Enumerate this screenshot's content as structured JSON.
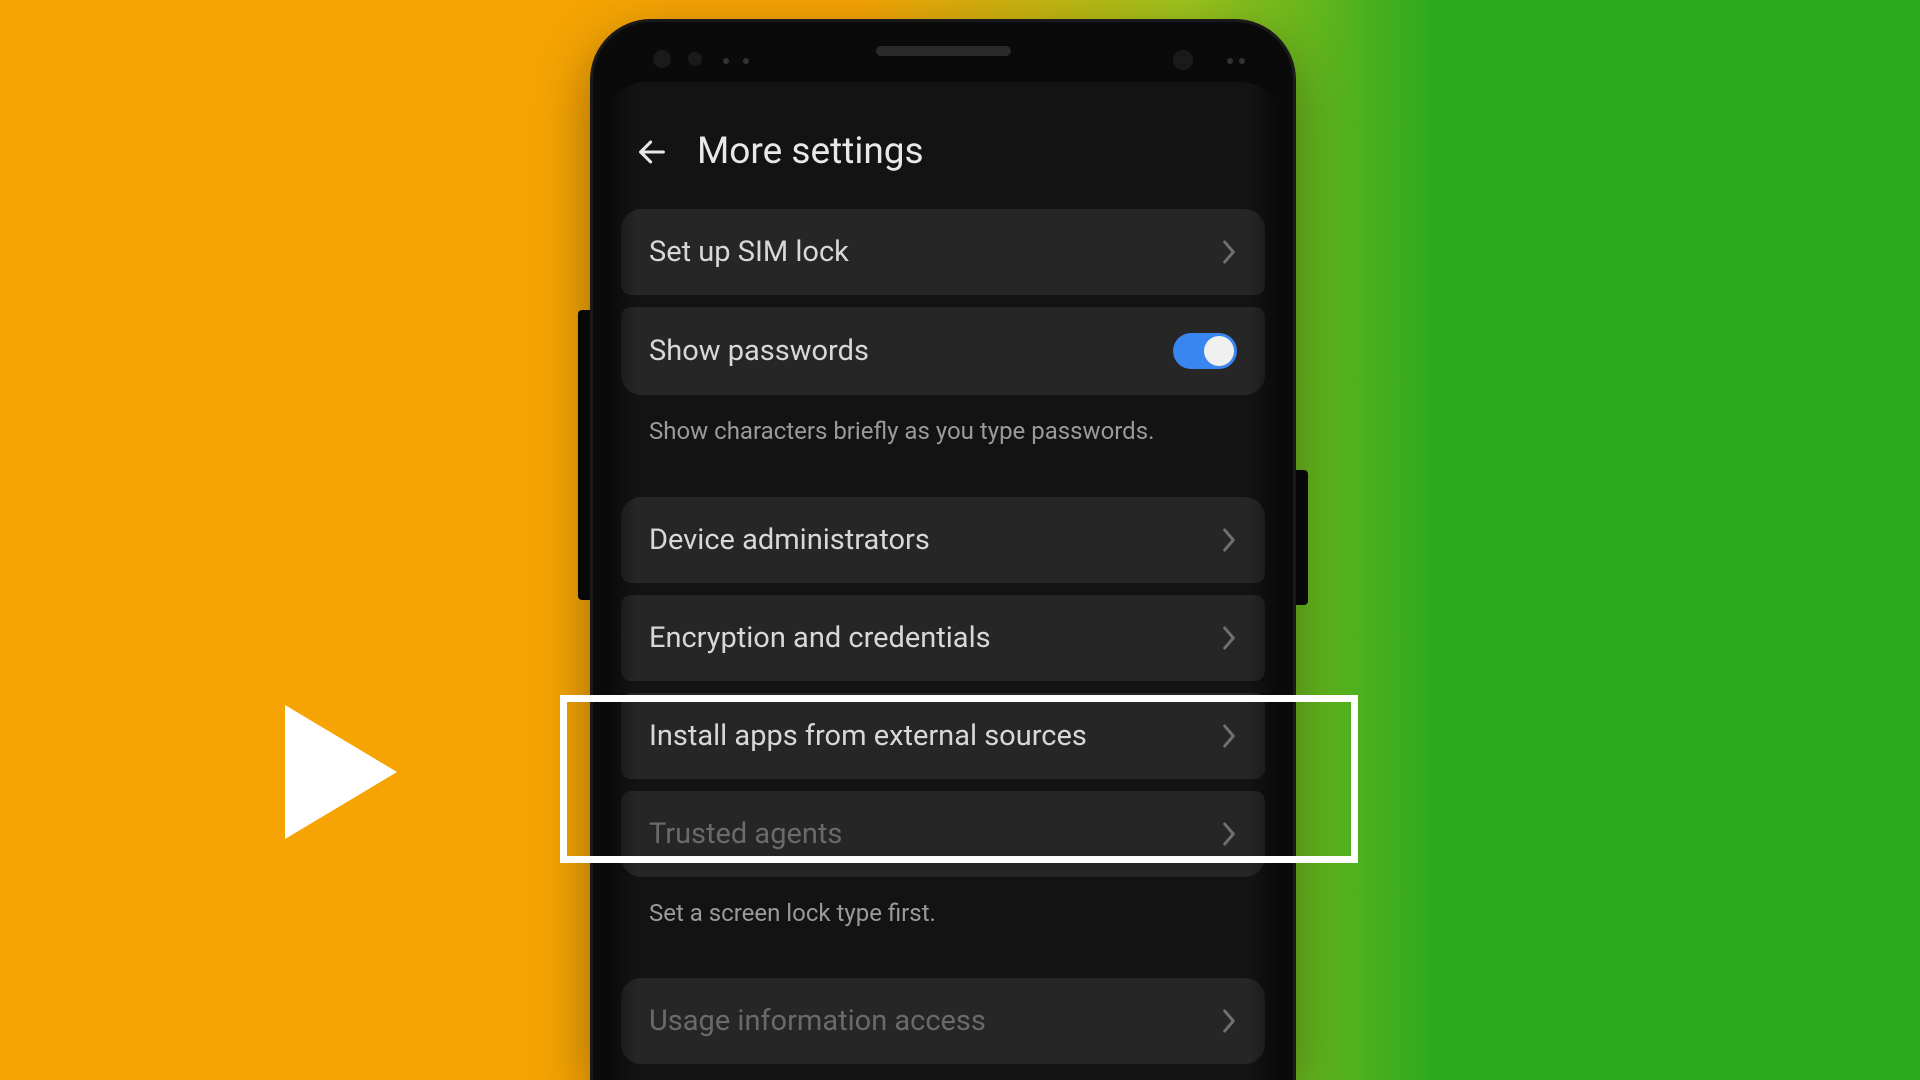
{
  "header": {
    "title": "More settings"
  },
  "settings": {
    "sim_lock": "Set up SIM lock",
    "show_passwords": "Show passwords",
    "show_passwords_desc": "Show characters briefly as you type passwords.",
    "device_admins": "Device administrators",
    "encryption": "Encryption and credentials",
    "install_external": "Install apps from external sources",
    "trusted_agents": "Trusted agents",
    "trusted_agents_desc": "Set a screen lock type first.",
    "usage_info": "Usage information access"
  },
  "toggle_states": {
    "show_passwords": true
  }
}
